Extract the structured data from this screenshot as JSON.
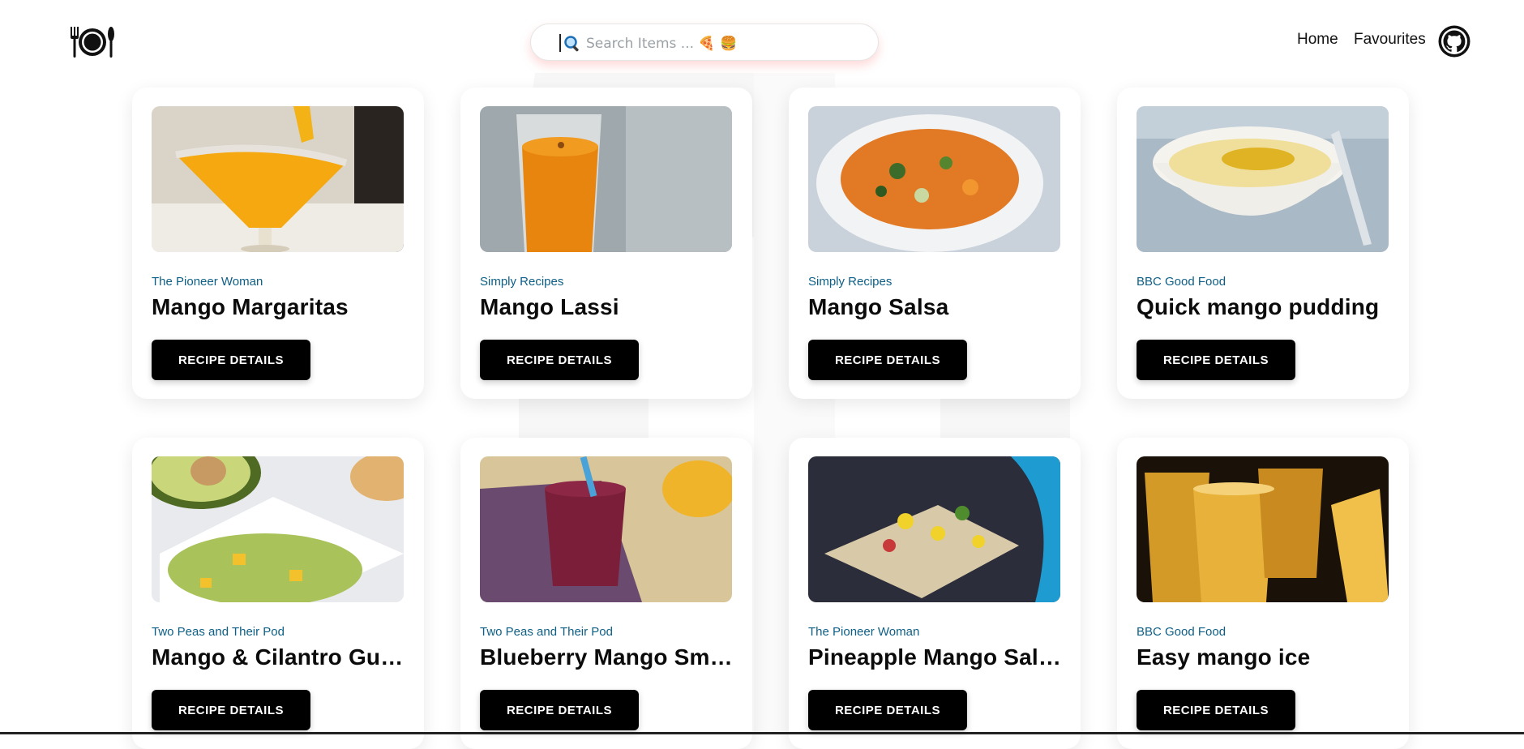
{
  "header": {
    "logo_icon": "plate-and-cutlery-icon",
    "search": {
      "placeholder": "Search Items ... 🍕 🍔",
      "value": "",
      "icon": "magnifier-icon"
    },
    "nav": [
      {
        "label": "Home"
      },
      {
        "label": "Favourites"
      }
    ],
    "github_icon": "github-icon"
  },
  "cards": [
    {
      "publisher": "The Pioneer Woman",
      "title": "Mango Margaritas",
      "button": "RECIPE DETAILS",
      "image": "mango-margarita-photo"
    },
    {
      "publisher": "Simply Recipes",
      "title": "Mango Lassi",
      "button": "RECIPE DETAILS",
      "image": "mango-lassi-photo"
    },
    {
      "publisher": "Simply Recipes",
      "title": "Mango Salsa",
      "button": "RECIPE DETAILS",
      "image": "mango-salsa-photo"
    },
    {
      "publisher": "BBC Good Food",
      "title": "Quick mango pudding",
      "button": "RECIPE DETAILS",
      "image": "mango-pudding-photo"
    },
    {
      "publisher": "Two Peas and Their Pod",
      "title": "Mango & Cilantro Gua...",
      "button": "RECIPE DETAILS",
      "image": "guacamole-photo"
    },
    {
      "publisher": "Two Peas and Their Pod",
      "title": "Blueberry Mango Smo...",
      "button": "RECIPE DETAILS",
      "image": "smoothie-photo"
    },
    {
      "publisher": "The Pioneer Woman",
      "title": "Pineapple Mango Salsa",
      "button": "RECIPE DETAILS",
      "image": "pineapple-salsa-photo"
    },
    {
      "publisher": "BBC Good Food",
      "title": "Easy mango ice",
      "button": "RECIPE DETAILS",
      "image": "mango-ice-photo"
    }
  ],
  "colors": {
    "publisher": "#0d5f86",
    "button_bg": "#000000",
    "button_text": "#ffffff",
    "search_glow": "#ff7878"
  }
}
